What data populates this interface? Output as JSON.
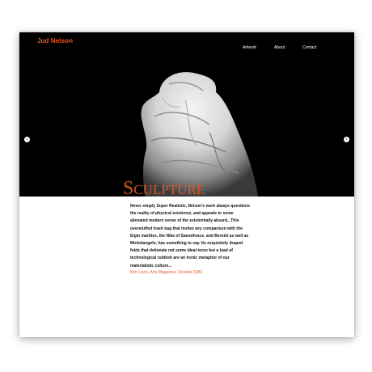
{
  "header": {
    "brand": "Jud Nelson",
    "nav": [
      {
        "label": "Artwork"
      },
      {
        "label": "About"
      },
      {
        "label": "Contact"
      }
    ]
  },
  "hero": {
    "title": "Sculpture",
    "image_alt": "Sculpture of a draped trash bag",
    "prev_icon": "chevron-left-icon",
    "next_icon": "chevron-right-icon"
  },
  "content": {
    "quote": "Never simply Super Realistic, Nelson's work always questions the reality of physical existence, and appeals to some alienated modern sense of the existentially absurd...This overstuffed trash bag that invites wry comparison with the Elgin marbles, the Nike of Samothrace, and Bernini as well as Michelangelo, has something to say. Its exquisitely draped folds that delineate not some ideal torso but a load of technological rubbish are an ironic metaphor of our materialistic culture...",
    "citation": "Kim Levin, Arts Magazine, October 1981"
  },
  "colors": {
    "accent": "#e8581c",
    "background": "#000000"
  }
}
